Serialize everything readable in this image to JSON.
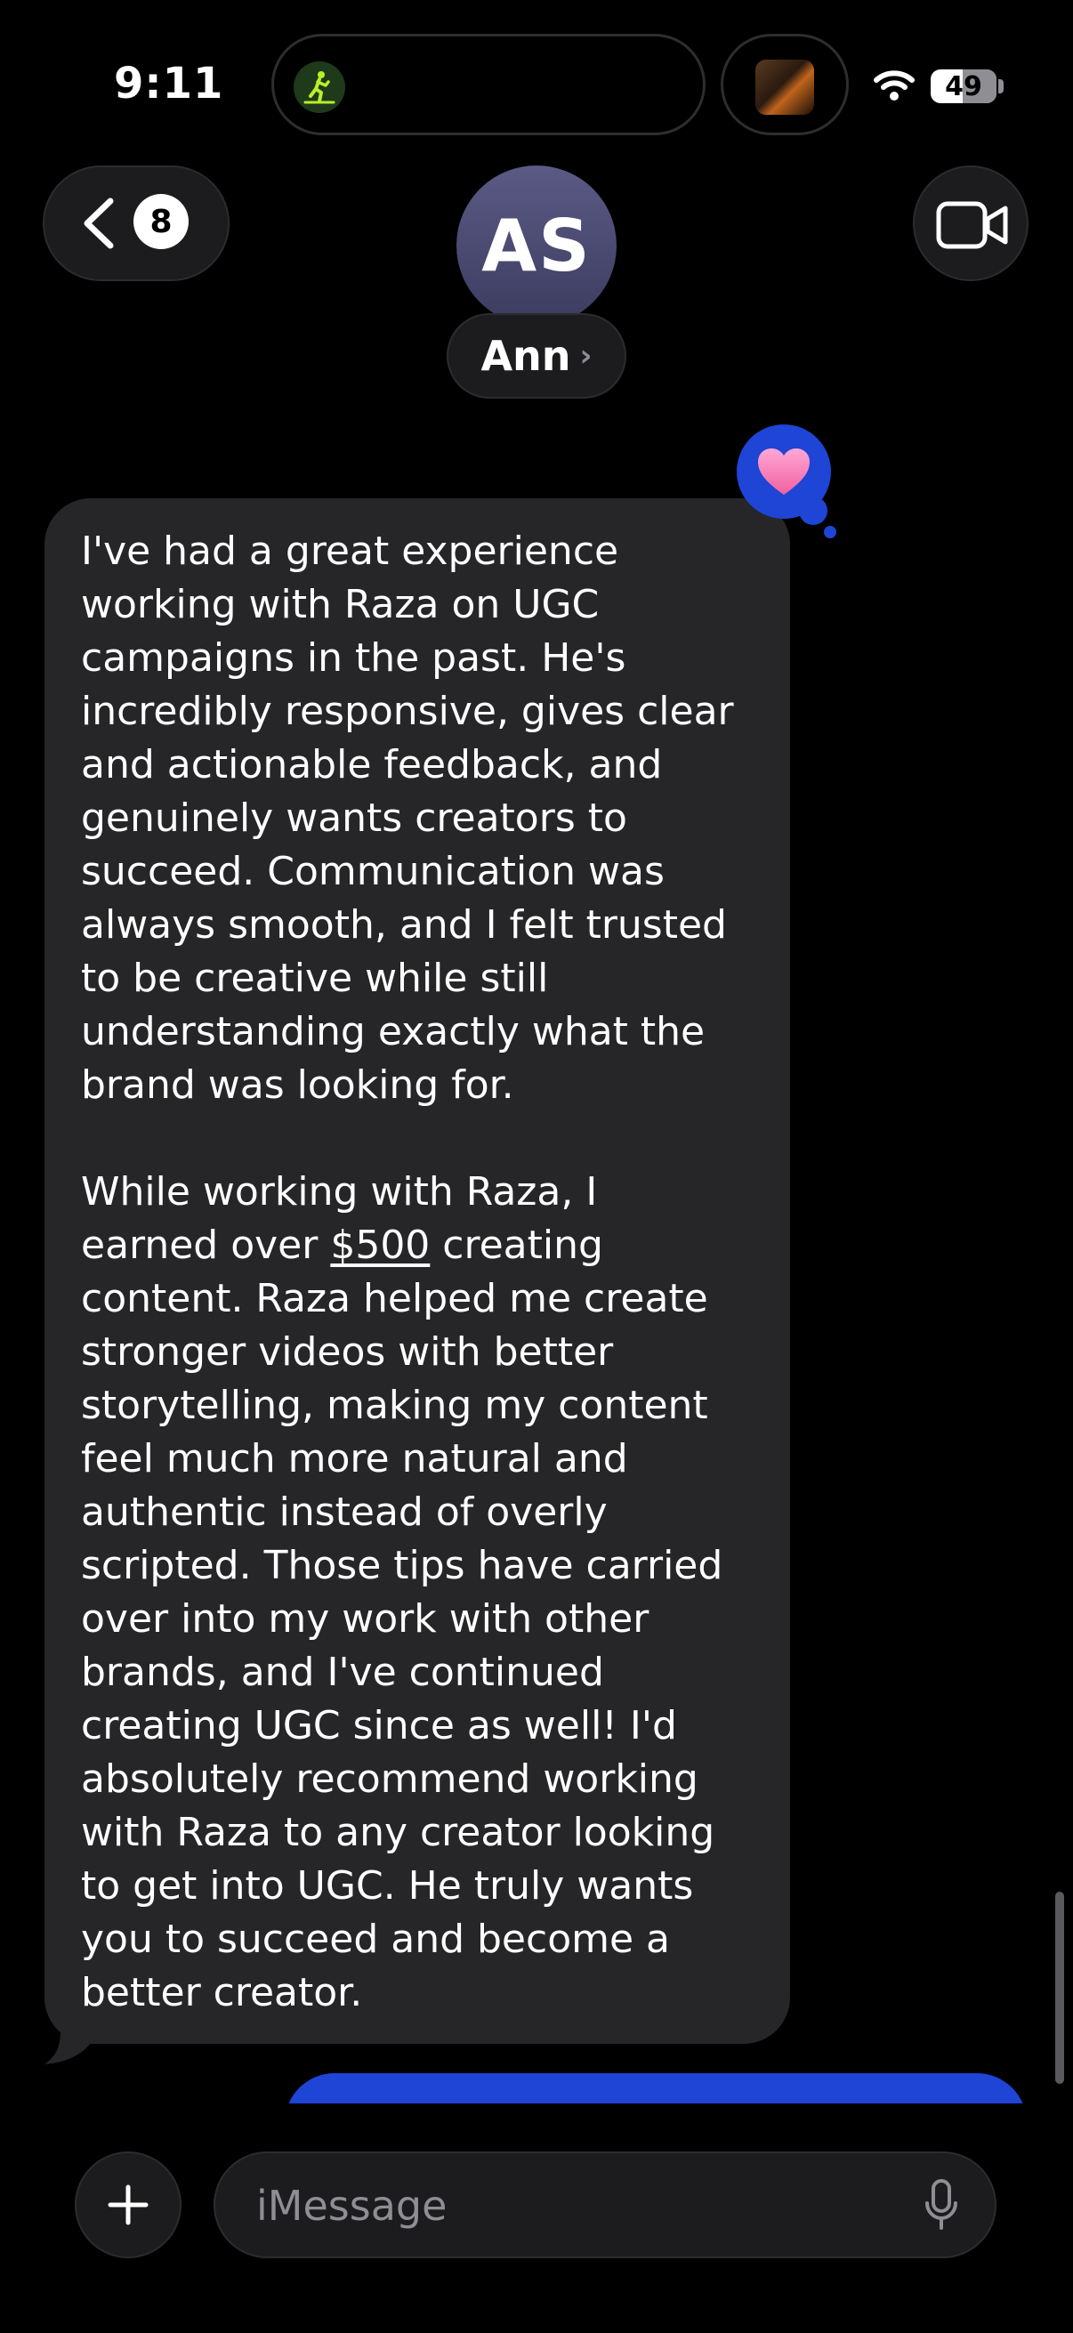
{
  "status_bar": {
    "time": "9:11",
    "battery": "49",
    "live_activity_icon": "treadmill-walk-icon",
    "media_thumbnail": "now-playing-thumbnail",
    "wifi_icon": "wifi-icon"
  },
  "header": {
    "back_badge_count": "8",
    "avatar_initials": "AS",
    "contact_name": "Ann",
    "contact_chevron": "›",
    "video_icon": "video-camera-icon"
  },
  "message": {
    "tapback": "heart",
    "paragraph1": "I've had a great experience\nworking with Raza on UGC\ncampaigns in the past. He's\nincredibly responsive, gives clear\nand actionable feedback, and\ngenuinely wants creators to\nsucceed. Communication was\nalways smooth, and I felt trusted\nto be creative while still\nunderstanding exactly what the\nbrand was looking for.",
    "paragraph2_pre": "While working with Raza, I\nearned over ",
    "paragraph2_link": "$500",
    "paragraph2_post": " creating\ncontent. Raza helped me create\nstronger videos with better\nstorytelling, making my content\nfeel much more natural and\nauthentic instead of overly\nscripted. Those tips have carried\nover into my work with other\nbrands, and I've continued\ncreating UGC since as well! I'd\nabsolutely recommend working\nwith Raza to any creator looking\nto get into UGC. He truly wants\nyou to succeed and become a\nbetter creator."
  },
  "compose": {
    "placeholder": "iMessage",
    "plus_icon": "plus-icon",
    "mic_icon": "microphone-icon"
  },
  "colors": {
    "background": "#000000",
    "received_bubble": "#262628",
    "sent_bubble": "#1e45d6",
    "control_background": "#1c1c1e",
    "secondary_text": "#8e8e93",
    "heart": "#f47fb8"
  }
}
